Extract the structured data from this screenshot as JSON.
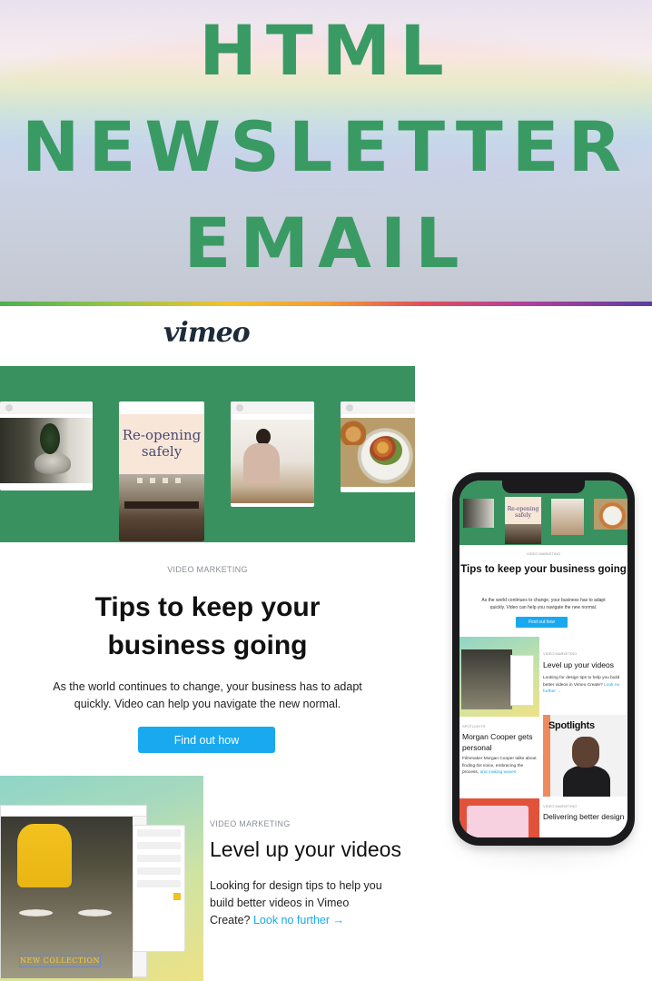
{
  "hero": {
    "line1": "HTML",
    "line2": "NEWSLETTER",
    "line3": "EMAIL"
  },
  "colors": {
    "brand_green": "#38915e",
    "title_green": "#3a9a64",
    "link_blue": "#18a9ee"
  },
  "newsletter": {
    "logo": "vimeo",
    "banner_card_text": "Re-opening safely",
    "section1": {
      "eyebrow": "VIDEO MARKETING",
      "headline_line1": "Tips to keep your",
      "headline_line2": "business going",
      "body_line1": "As the world continues to change, your business has to adapt",
      "body_line2": "quickly. Video can help you navigate the new normal.",
      "cta": "Find out how"
    },
    "section2": {
      "eyebrow": "VIDEO MARKETING",
      "title": "Level up your videos",
      "body": "Looking for design tips to help you build better videos in Vimeo Create?",
      "link": "Look no further →",
      "image_caption": "NEW COLLECTION"
    }
  },
  "phone": {
    "banner_card_text": "Re-opening safely",
    "eyebrow": "VIDEO MARKETING",
    "headline": "Tips to keep your business going",
    "body": "As the world continues to change, your business has to adapt quickly. Video can help you navigate the new normal.",
    "cta": "Find out how",
    "s2_eyebrow": "VIDEO MARKETING",
    "s2_title": "Level up your videos",
    "s2_body": "Looking for design tips to help you build better videos in Vimeo Create?",
    "s2_link": "Look no further →",
    "s3_eyebrow": "SPOTLIGHTS",
    "s3_title": "Morgan Cooper gets personal",
    "s3_body": "Filmmaker Morgan Cooper talks about finding his voice, embracing the process,",
    "s3_link": "and making waves",
    "spotlights_word": "Spotlights",
    "s4_eyebrow": "VIDEO MARKETING",
    "s4_title": "Delivering better design"
  }
}
